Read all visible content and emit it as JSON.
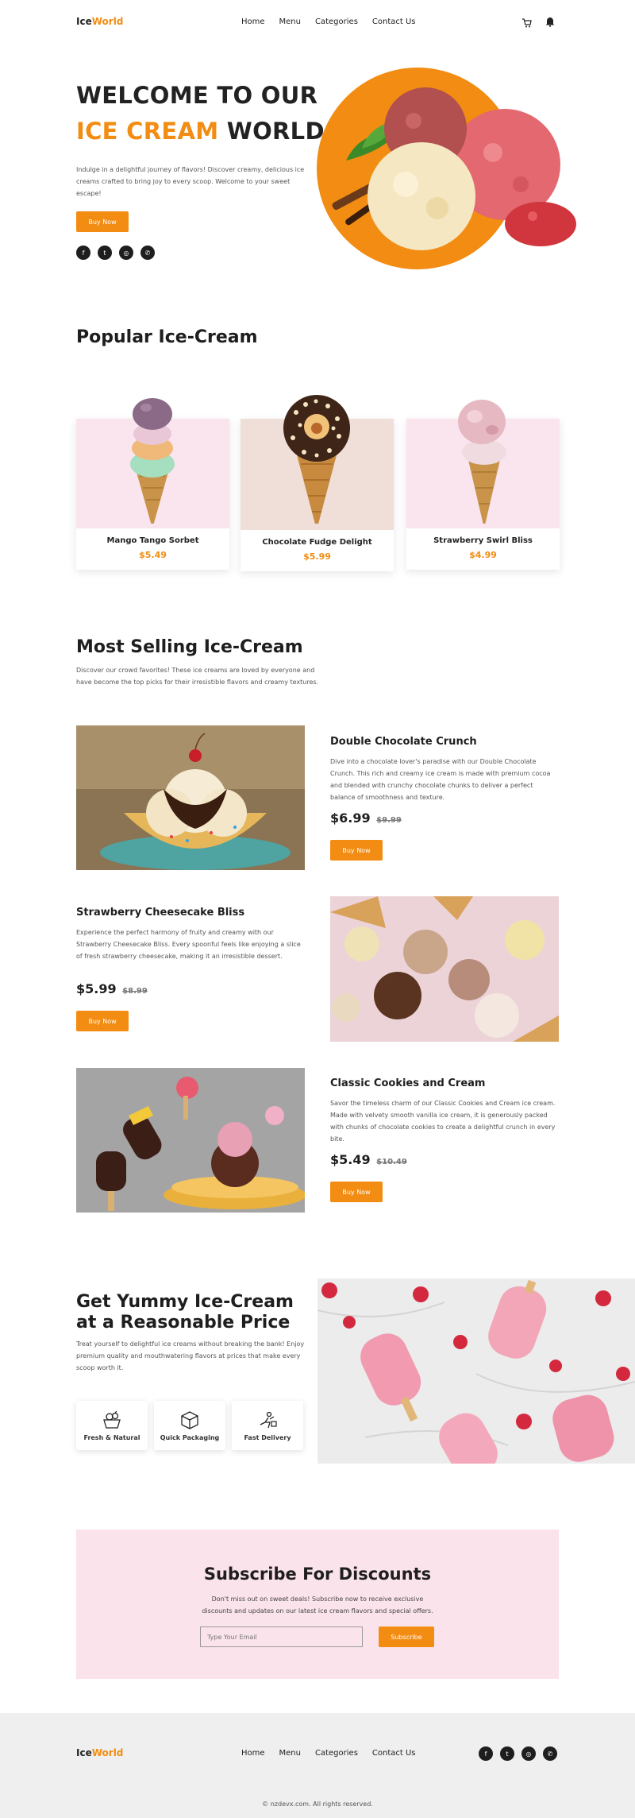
{
  "brand": {
    "part1": "Ice",
    "part2": "World"
  },
  "nav": {
    "items": [
      "Home",
      "Menu",
      "Categories",
      "Contact Us"
    ]
  },
  "hero": {
    "title_line1": "WELCOME TO OUR",
    "title_highlight": "ICE CREAM",
    "title_rest": " WORLD",
    "description": "Indulge in a delightful journey of flavors! Discover creamy, delicious ice creams crafted to bring joy to every scoop. Welcome to your sweet escape!",
    "button": "Buy Now"
  },
  "popular": {
    "title": "Popular Ice-Cream",
    "items": [
      {
        "name": "Mango Tango Sorbet",
        "price": "$5.49"
      },
      {
        "name": "Chocolate Fudge Delight",
        "price": "$5.99"
      },
      {
        "name": "Strawberry Swirl Bliss",
        "price": "$4.99"
      }
    ]
  },
  "most_selling": {
    "title": "Most Selling Ice-Cream",
    "description": "Discover our crowd favorites! These ice creams are loved by everyone and have become the top picks for their irresistible flavors and creamy textures.",
    "products": [
      {
        "title": "Double Chocolate Crunch",
        "description": "Dive into a chocolate lover's paradise with our Double Chocolate Crunch. This rich and creamy ice cream is made with premium cocoa and blended with crunchy chocolate chunks to deliver a perfect balance of smoothness and texture.",
        "price": "$6.99",
        "old_price": "$9.99",
        "button": "Buy Now"
      },
      {
        "title": "Strawberry Cheesecake Bliss",
        "description": "Experience the perfect harmony of fruity and creamy with our Strawberry Cheesecake Bliss. Every spoonful feels like enjoying a slice of fresh strawberry cheesecake, making it an irresistible dessert.",
        "price": "$5.99",
        "old_price": "$8.99",
        "button": "Buy Now"
      },
      {
        "title": "Classic Cookies and Cream",
        "description": "Savor the timeless charm of our Classic Cookies and Cream ice cream. Made with velvety smooth vanilla ice cream, it is generously packed with chunks of chocolate cookies to create a delightful crunch in every bite.",
        "price": "$5.49",
        "old_price": "$10.49",
        "button": "Buy Now"
      }
    ]
  },
  "yummy": {
    "title": "Get Yummy Ice-Cream at a Reasonable Price",
    "description": "Treat yourself to delightful ice creams without breaking the bank! Enjoy premium quality and mouthwatering flavors at prices that make every scoop worth it.",
    "features": [
      "Fresh & Natural",
      "Quick Packaging",
      "Fast Delivery"
    ]
  },
  "subscribe": {
    "title": "Subscribe For Discounts",
    "description": "Don't miss out on sweet deals! Subscribe now to receive exclusive discounts and updates on our latest ice cream flavors and special offers.",
    "placeholder": "Type Your Email",
    "button": "Subscribe"
  },
  "footer": {
    "copyright": "© nzdevx.com. All rights reserved."
  },
  "colors": {
    "accent": "#f28c12",
    "pink_bg": "#fbe3ec",
    "footer_bg": "#efefef",
    "dark": "#1e1e1e"
  },
  "icons": [
    "cart-icon",
    "bell-icon",
    "facebook-icon",
    "twitter-icon",
    "instagram-icon",
    "whatsapp-icon",
    "fruit-basket-icon",
    "package-box-icon",
    "delivery-icon"
  ]
}
